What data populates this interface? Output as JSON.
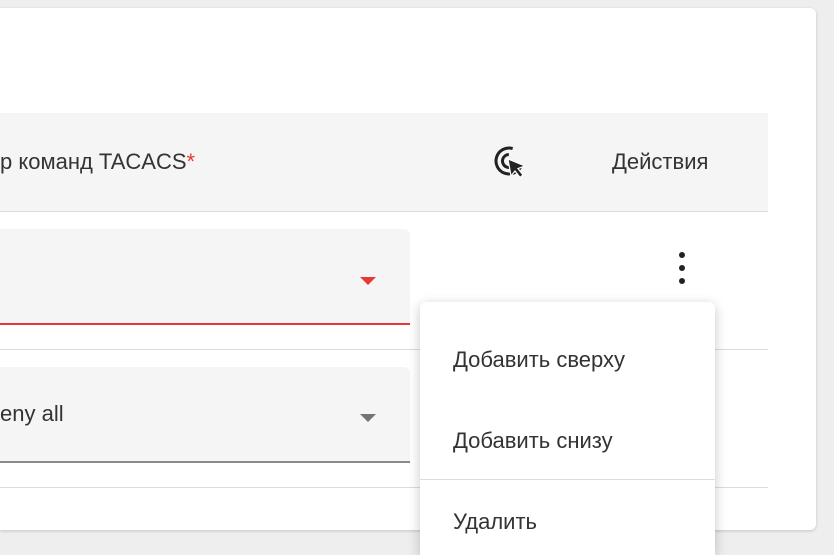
{
  "table": {
    "header": {
      "column_title": "р команд TACACS",
      "required_marker": "*",
      "select_icon": "cursor-click-icon",
      "actions_label": "Действия"
    },
    "rows": [
      {
        "value": "",
        "state": "error"
      },
      {
        "value": "eny all",
        "state": "default"
      }
    ]
  },
  "context_menu": {
    "items": [
      {
        "label": "Добавить сверху"
      },
      {
        "label": "Добавить снизу"
      },
      {
        "label": "Удалить"
      }
    ]
  },
  "colors": {
    "error": "#e53935",
    "header_bg": "#f5f5f5",
    "divider": "#dcdcdc"
  }
}
